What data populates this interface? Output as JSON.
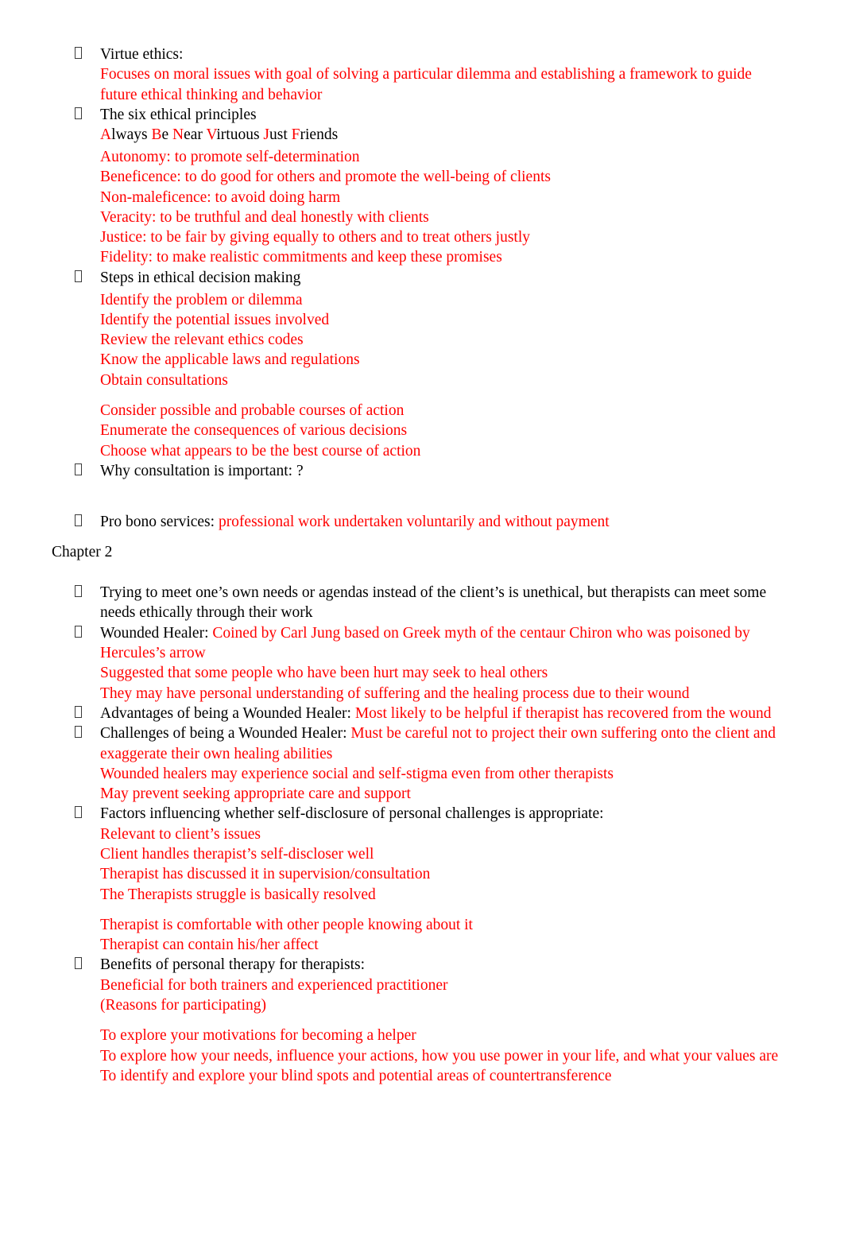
{
  "document": {
    "title": "Ethics and Counseling Study Notes",
    "colors": {
      "body_text": "#000000",
      "annotation_text": "#FF0000",
      "page_background": "#FFFFFF"
    },
    "bullet_glyph": "missing-glyph-box",
    "chapter_heading": "Chapter 2",
    "sections": {
      "virtue_ethics": {
        "heading": "Virtue ethics:",
        "answer_lines": [
          "Focuses on moral issues with goal of solving a particular dilemma and establishing a framework to guide future ethical thinking and behavior"
        ]
      },
      "six_principles": {
        "heading": "The six ethical principles",
        "mnemonic": {
          "words": [
            {
              "initial": "A",
              "rest": "lways"
            },
            {
              "initial": "B",
              "rest": "e"
            },
            {
              "initial": "N",
              "rest": "ear"
            },
            {
              "initial": "V",
              "rest": "irtuous"
            },
            {
              "initial": "J",
              "rest": "ust"
            },
            {
              "initial": "F",
              "rest": "riends"
            }
          ]
        },
        "principles": [
          "Autonomy: to promote self-determination",
          "Beneficence: to do good for others and promote the well-being of clients",
          "Non-maleficence: to avoid doing harm",
          "Veracity: to be truthful and deal honestly with clients",
          "Justice: to be fair by giving equally to others and to treat others justly",
          "Fidelity: to make realistic commitments and keep these promises"
        ]
      },
      "decision_steps": {
        "heading": "Steps in ethical decision making",
        "steps_group_one": [
          "Identify the problem or dilemma",
          "Identify the potential issues involved",
          "Review the relevant ethics codes",
          "Know the applicable laws and regulations",
          "Obtain consultations"
        ],
        "steps_group_two": [
          "Consider possible and probable courses of action",
          "Enumerate the consequences of various decisions",
          "Choose what appears to be the best course of action"
        ]
      },
      "consultation": {
        "heading": "Why consultation is important: ?"
      },
      "pro_bono": {
        "label": "Pro bono services: ",
        "answer": "professional work undertaken voluntarily and without payment"
      },
      "own_needs": {
        "text": "Trying to meet one’s own needs or agendas instead of the client’s is unethical, but therapists can meet some needs ethically through their work"
      },
      "wounded_healer": {
        "label": "Wounded Healer: ",
        "answer": "Coined by Carl Jung based on Greek myth of the centaur Chiron who was poisoned by Hercules’s arrow",
        "extra_lines": [
          "Suggested that some people who have been hurt may seek to heal others",
          "They may have personal understanding of suffering and the healing process due to their wound"
        ]
      },
      "wounded_healer_advantages": {
        "label": "Advantages of being a Wounded Healer: ",
        "answer": "Most likely to be helpful if therapist has recovered from the wound"
      },
      "wounded_healer_challenges": {
        "label": "Challenges of being a Wounded Healer: ",
        "answer": "Must be careful not to project their own suffering onto the client and exaggerate their own healing abilities",
        "extra_lines": [
          "Wounded healers may experience social and self-stigma even from other therapists",
          "May prevent seeking appropriate care and support"
        ]
      },
      "self_disclosure": {
        "heading": "Factors influencing whether self-disclosure of personal challenges is appropriate:",
        "factors_group_one": [
          "Relevant to client’s issues",
          "Client handles therapist’s self-discloser well",
          "Therapist has discussed it in supervision/consultation",
          "The Therapists struggle is basically resolved"
        ],
        "factors_group_two": [
          "Therapist is comfortable with other people knowing about it",
          "Therapist can contain his/her affect"
        ]
      },
      "personal_therapy": {
        "heading": "Benefits of personal therapy for therapists:",
        "lines_group_one": [
          "Beneficial for both trainers and experienced practitioner",
          "(Reasons for participating)"
        ],
        "lines_group_two": [
          "To explore your motivations for becoming a helper",
          "To explore how your needs, influence your actions, how you use power in your life, and what your values are",
          "To identify and explore your blind spots and potential areas of countertransference"
        ]
      }
    }
  }
}
